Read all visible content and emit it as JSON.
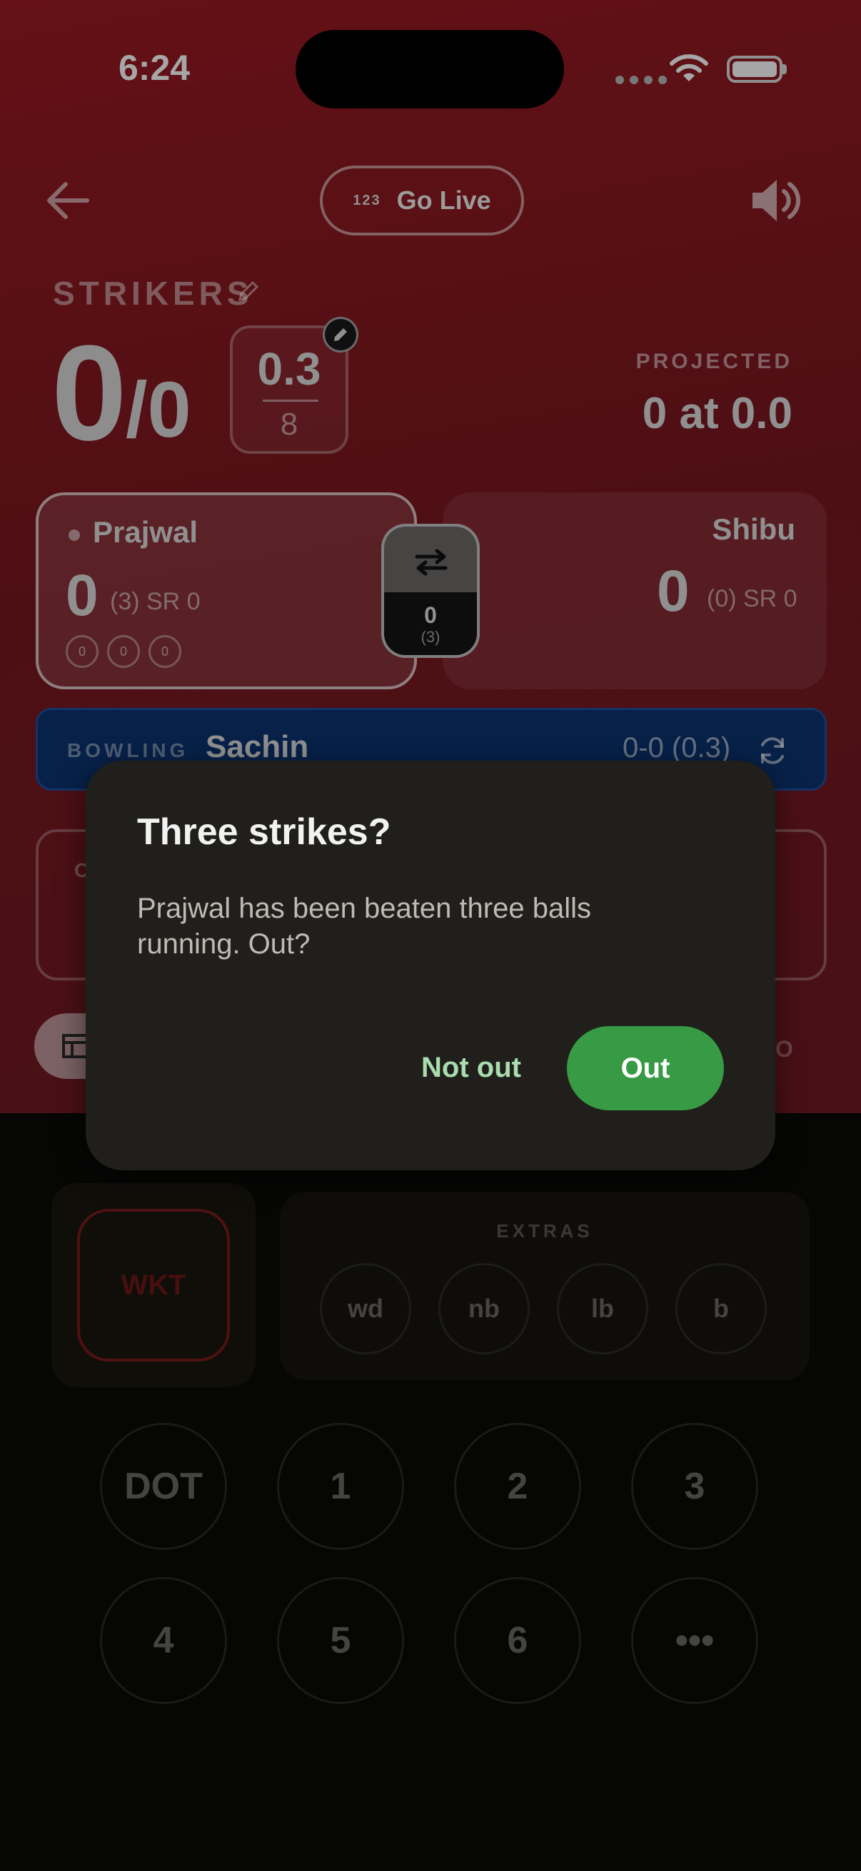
{
  "status": {
    "time": "6:24"
  },
  "header": {
    "go_live_icon_text": "123",
    "go_live_label": "Go Live"
  },
  "score": {
    "title": "STRIKERS",
    "runs": "0",
    "wickets": "/0",
    "overs": "0.3",
    "total_overs": "8",
    "projected_label": "PROJECTED",
    "projected_value": "0 at 0.0"
  },
  "batters": {
    "striker": {
      "name": "Prajwal",
      "runs": "0",
      "stats": "(3) SR 0",
      "balls": [
        "0",
        "0",
        "0"
      ]
    },
    "non_striker": {
      "name": "Shibu",
      "runs": "0",
      "stats": "(0) SR 0"
    },
    "partnership": {
      "runs": "0",
      "balls": "(3)"
    }
  },
  "bowling": {
    "label": "BOWLING",
    "name": "Sachin",
    "figures": "0-0 (0.3)"
  },
  "ghost": {
    "left_letter": "O",
    "right_letter": "O"
  },
  "pad": {
    "wicket": "WKT",
    "extras_label": "EXTRAS",
    "extras": [
      "wd",
      "nb",
      "lb",
      "b"
    ],
    "keys": [
      "DOT",
      "1",
      "2",
      "3",
      "4",
      "5",
      "6",
      "•••"
    ]
  },
  "dialog": {
    "title": "Three strikes?",
    "body": "Prajwal has been beaten three balls running. Out?",
    "cancel": "Not out",
    "confirm": "Out"
  },
  "colors": {
    "accent_red": "#9a1a22",
    "bowling_blue": "#0b3470",
    "confirm_green": "#379a45"
  }
}
